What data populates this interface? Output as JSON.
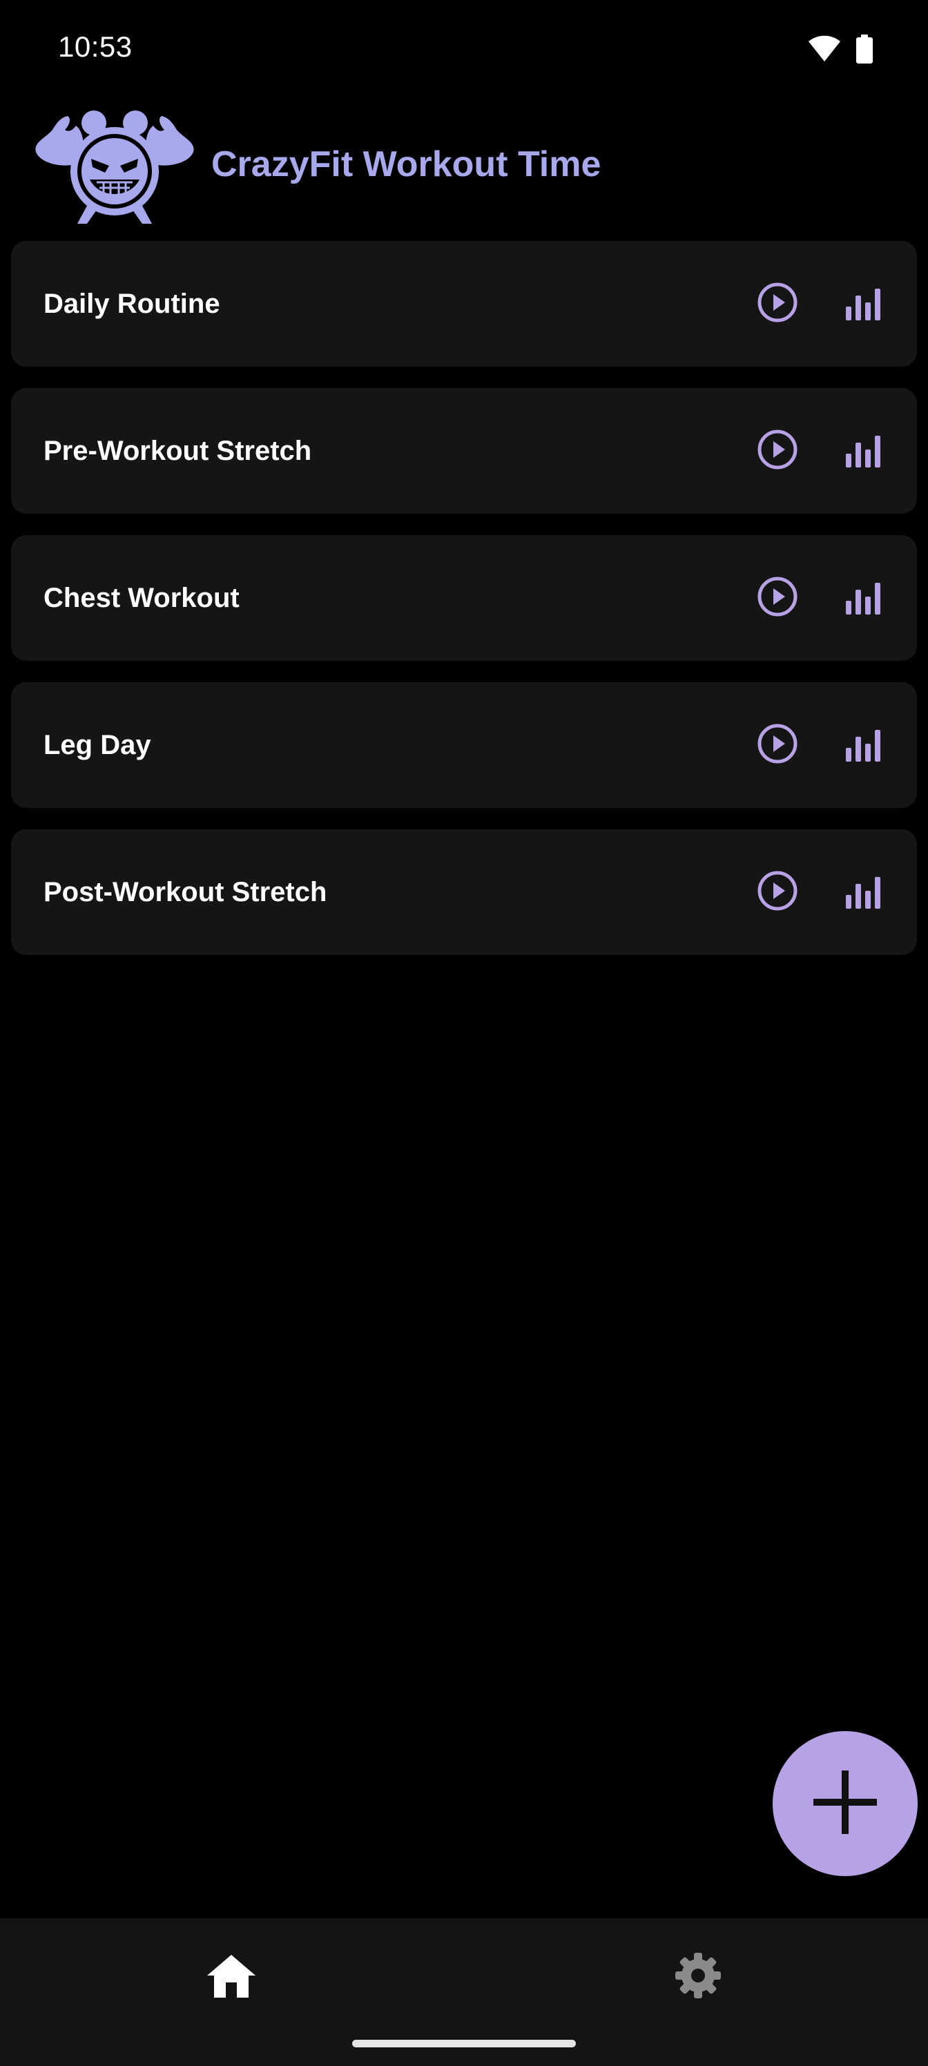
{
  "status_bar": {
    "time": "10:53",
    "icons": [
      "wifi-icon",
      "battery-icon"
    ]
  },
  "header": {
    "title": "CrazyFit Workout Time",
    "logo_icon": "muscle-clock-logo"
  },
  "routines": [
    {
      "name": "Daily Routine"
    },
    {
      "name": "Pre-Workout Stretch"
    },
    {
      "name": "Chest Workout"
    },
    {
      "name": "Leg Day"
    },
    {
      "name": "Post-Workout Stretch"
    }
  ],
  "routine_actions": {
    "play_icon": "play-circle-icon",
    "stats_icon": "bar-chart-icon"
  },
  "fab": {
    "icon": "plus-icon"
  },
  "bottom_nav": {
    "items": [
      {
        "icon": "home-icon",
        "selected": true
      },
      {
        "icon": "gear-icon",
        "selected": false
      }
    ]
  },
  "colors": {
    "background": "#000000",
    "card": "#151515",
    "accent": "#b8a2e6",
    "title": "#a7a9ec",
    "nav_background": "#141414"
  }
}
